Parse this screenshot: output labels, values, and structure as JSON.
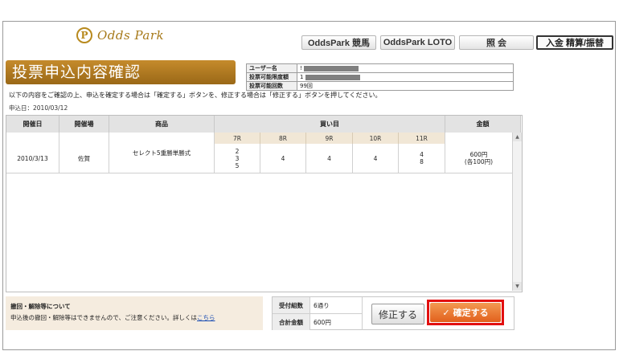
{
  "header": {
    "logo_mark": "P",
    "logo_text": "Odds Park",
    "nav": [
      "OddsPark 競馬",
      "OddsPark LOTO",
      "照 会",
      "入金 精算/振替"
    ]
  },
  "page": {
    "title": "投票申込内容確認",
    "instruction": "以下の内容をご確認の上、申込を確定する場合は「確定する」ボタンを、修正する場合は「修正する」ボタンを押してください。",
    "apply_date": "申込日：2010/03/12"
  },
  "user_info": {
    "rows": [
      {
        "label": "ユーザー名",
        "value": "!"
      },
      {
        "label": "投票可能限度額",
        "value": "1"
      },
      {
        "label": "投票可能回数",
        "value": "99回"
      }
    ]
  },
  "table": {
    "headers": [
      "開催日",
      "開催場",
      "商品",
      "買い目",
      "金額"
    ],
    "races": [
      "7R",
      "8R",
      "9R",
      "10R",
      "11R"
    ],
    "row": {
      "date": "2010/3/13",
      "venue": "佐賀",
      "product": "セレクト5重勝単勝式",
      "r7": "2\n3\n5",
      "r8": "4",
      "r9": "4",
      "r10": "4",
      "r11": "4\n8",
      "amount": "600円\n(各100円)"
    }
  },
  "notice": {
    "title": "撤回・解除等について",
    "text": "申込後の撤回・解除等はできませんので、ご注意ください。詳しくは",
    "link": "こちら"
  },
  "totals": {
    "combo_label": "受付組数",
    "combo_value": "6通り",
    "total_label": "合計金額",
    "total_value": "600円"
  },
  "buttons": {
    "fix": "修正する",
    "confirm": "確定する",
    "confirm_icon": "✓"
  },
  "colors": {
    "title_bar": "#b07a22",
    "confirm": "#e8732e",
    "highlight": "#e21010"
  }
}
